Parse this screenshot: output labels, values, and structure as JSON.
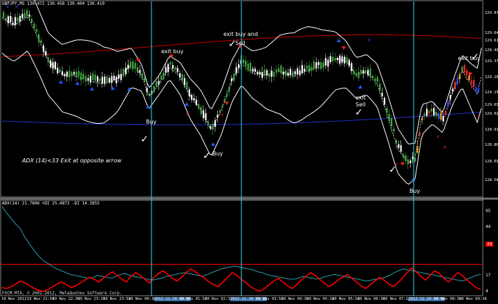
{
  "window": {
    "symbol_header": "GBPJPY,M5  130.472 130.458 130.404 130.419",
    "copyright": "FXCM MT4, © 2001-2012, MetaQuotes Software Corp."
  },
  "subwindow": {
    "header": "ADX(14) 21.7606 +DI 25.4873 -DI 14.3855"
  },
  "colors": {
    "background": "#000000",
    "candle_up": "#44aa44",
    "candle_down": "#ffffff",
    "band": "#ffffff",
    "ma_red": "#cc0000",
    "ma_blue": "#2233cc",
    "vline": "#33bbcc",
    "adx_line": "#30b0c0",
    "plus_di": "#ff0000",
    "level": "#ff0000",
    "buy_arrow": "#1e5cff",
    "sell_arrow": "#ff2020"
  },
  "annotations": [
    {
      "id": "exit-buy-1",
      "text": "exit buy"
    },
    {
      "id": "exit-buy-sell",
      "text": "exit buy and"
    },
    {
      "id": "sell-1",
      "text": "Sell"
    },
    {
      "id": "exit-sell",
      "text": "exit"
    },
    {
      "id": "sell-2",
      "text": "Sell"
    },
    {
      "id": "buy-1",
      "text": "Buy"
    },
    {
      "id": "buy-2",
      "text": "Buy"
    },
    {
      "id": "buy-3",
      "text": "Buy"
    },
    {
      "id": "exit-buy-2",
      "text": "exit buy"
    },
    {
      "id": "adx-note",
      "text": "ADX (14)<33 Exit at opposite arrow"
    }
  ],
  "price_axis": [
    "129.875",
    "129.640",
    "129.610",
    "129.490",
    "129.375",
    "129.265",
    "129.150",
    "129.035",
    "129.025",
    "128.915",
    "128.805",
    "128.690",
    "128.585"
  ],
  "adx_axis": [
    {
      "label": "95",
      "highlight": false
    },
    {
      "label": "44",
      "highlight": false
    },
    {
      "label": "33",
      "highlight": true
    },
    {
      "label": "17",
      "highlight": false
    },
    {
      "label": "4",
      "highlight": false
    }
  ],
  "time_axis": [
    {
      "label": "19 Nov 2012",
      "highlight": false
    },
    {
      "label": "19 Nov 21:50",
      "highlight": false
    },
    {
      "label": "19 Nov 22:30",
      "highlight": false
    },
    {
      "label": "19 Nov 23:10",
      "highlight": false
    },
    {
      "label": "19 Nov 23:50",
      "highlight": false
    },
    {
      "label": "20 Nov 00:30",
      "highlight": false
    },
    {
      "label": "2012.11.20 00:50",
      "highlight": true
    },
    {
      "label": "20 Nov 01:50",
      "highlight": false
    },
    {
      "label": "20 Nov 02:30",
      "highlight": false
    },
    {
      "label": "2012.11.20 03:15",
      "highlight": true
    },
    {
      "label": "20 Nov 03:50",
      "highlight": false
    },
    {
      "label": "20 Nov 04:30",
      "highlight": false
    },
    {
      "label": "20 Nov 05:10",
      "highlight": false
    },
    {
      "label": "20 Nov 05:50",
      "highlight": false
    },
    {
      "label": "20 Nov 06:30",
      "highlight": false
    },
    {
      "label": "20 Nov 07:10",
      "highlight": false
    },
    {
      "label": "2012.11.20 07:50",
      "highlight": true
    },
    {
      "label": "20 Nov 08:30",
      "highlight": false
    },
    {
      "label": "20 Nov 09:10",
      "highlight": false
    }
  ],
  "chart_data": {
    "type": "line",
    "series": [
      {
        "name": "ADX",
        "values": [
          95,
          88,
          82,
          76,
          71,
          62,
          55,
          48,
          42,
          37,
          34,
          31,
          28,
          26,
          24,
          22,
          21,
          20,
          19,
          18,
          19,
          21,
          20,
          19,
          18,
          20,
          22,
          23,
          21,
          20,
          19,
          18,
          17,
          16,
          17,
          18,
          20,
          21,
          22,
          23,
          24,
          23,
          22,
          21,
          20,
          22,
          24,
          26,
          28,
          29,
          30,
          31,
          30,
          29,
          28,
          27,
          25,
          24,
          22,
          21,
          20,
          19,
          18,
          17,
          17,
          18,
          20,
          19,
          18,
          17,
          18,
          20,
          21,
          22,
          21,
          20,
          19,
          18,
          17,
          16,
          15,
          16,
          17,
          18,
          19,
          21,
          24,
          26,
          28,
          27,
          26,
          25,
          24,
          23,
          22,
          21,
          20,
          19,
          18,
          17,
          16,
          15,
          17,
          19,
          21,
          22
        ]
      },
      {
        "name": "+DI",
        "values": [
          8,
          7,
          9,
          12,
          15,
          13,
          10,
          7,
          5,
          4,
          6,
          9,
          12,
          14,
          11,
          8,
          10,
          13,
          16,
          19,
          17,
          14,
          18,
          22,
          25,
          21,
          17,
          14,
          20,
          24,
          21,
          17,
          13,
          19,
          23,
          26,
          22,
          18,
          15,
          19,
          24,
          28,
          25,
          21,
          18,
          14,
          11,
          9,
          14,
          19,
          24,
          21,
          17,
          13,
          9,
          6,
          4,
          7,
          11,
          15,
          18,
          14,
          10,
          7,
          11,
          16,
          20,
          24,
          21,
          17,
          13,
          9,
          12,
          16,
          19,
          22,
          18,
          14,
          10,
          7,
          11,
          15,
          19,
          16,
          12,
          9,
          13,
          18,
          24,
          29,
          25,
          20,
          16,
          21,
          26,
          23,
          18,
          14,
          19,
          24,
          21,
          16,
          12,
          8,
          6
        ]
      }
    ],
    "levels": [
      33
    ],
    "ylim": [
      0,
      100
    ]
  }
}
